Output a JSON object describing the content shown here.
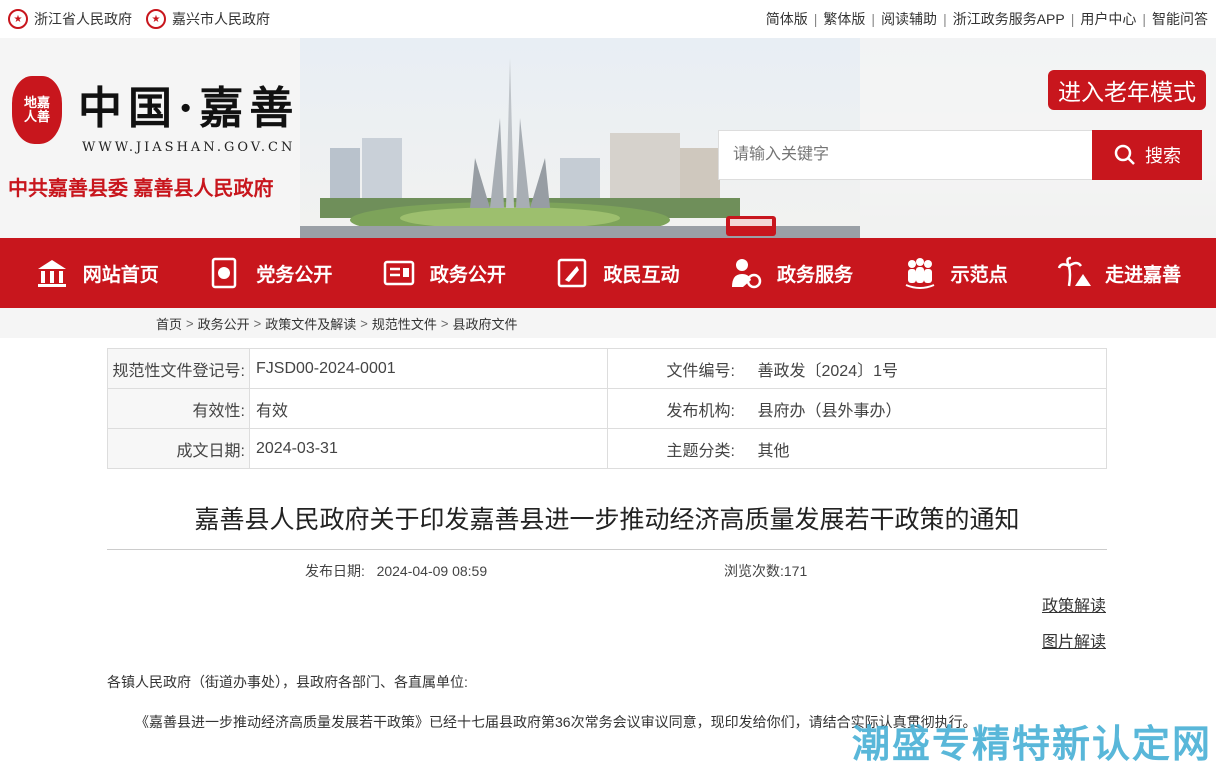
{
  "topbar": {
    "sites": [
      "浙江省人民政府",
      "嘉兴市人民政府"
    ],
    "links": [
      "简体版",
      "繁体版",
      "阅读辅助",
      "浙江政务服务APP",
      "用户中心",
      "智能问答"
    ]
  },
  "header": {
    "seal_text": "地嘉人善",
    "title": "中国·嘉善",
    "url": "WWW.JIASHAN.GOV.CN",
    "subtitle": "中共嘉善县委  嘉善县人民政府",
    "elder_mode": "进入老年模式",
    "search_placeholder": "请输入关键字",
    "search_button": "搜索"
  },
  "nav": [
    {
      "label": "网站首页",
      "icon": "home-icon"
    },
    {
      "label": "党务公开",
      "icon": "party-icon"
    },
    {
      "label": "政务公开",
      "icon": "gov-info-icon"
    },
    {
      "label": "政民互动",
      "icon": "interaction-icon"
    },
    {
      "label": "政务服务",
      "icon": "service-icon"
    },
    {
      "label": "示范点",
      "icon": "people-icon"
    },
    {
      "label": "走进嘉善",
      "icon": "palm-icon"
    }
  ],
  "breadcrumb": [
    "首页",
    "政务公开",
    "政策文件及解读",
    "规范性文件",
    "县政府文件"
  ],
  "meta": {
    "reg_no_label": "规范性文件登记号:",
    "reg_no": "FJSD00-2024-0001",
    "doc_no_label": "文件编号:",
    "doc_no": "善政发〔2024〕1号",
    "validity_label": "有效性:",
    "validity": "有效",
    "issuer_label": "发布机构:",
    "issuer": "县府办（县外事办）",
    "date_label": "成文日期:",
    "date": "2024-03-31",
    "topic_label": "主题分类:",
    "topic": "其他"
  },
  "article": {
    "title": "嘉善县人民政府关于印发嘉善县进一步推动经济高质量发展若干政策的通知",
    "pub_label": "发布日期:",
    "pub_date": "2024-04-09 08:59",
    "views_label": "浏览次数:",
    "views": "171",
    "link_policy": "政策解读",
    "link_image": "图片解读",
    "salutation": "各镇人民政府（街道办事处），县政府各部门、各直属单位:",
    "body": "《嘉善县进一步推动经济高质量发展若干政策》已经十七届县政府第36次常务会议审议同意，现印发给你们，请结合实际认真贯彻执行。"
  },
  "watermark": "潮盛专精特新认定网",
  "colors": {
    "brand_red": "#c8161d",
    "watermark": "#3caad2"
  }
}
